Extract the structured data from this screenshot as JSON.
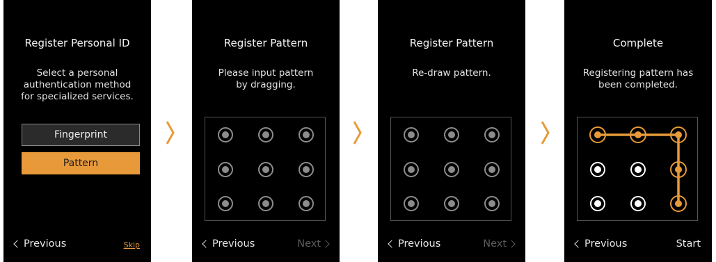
{
  "screens": [
    {
      "title": "Register Personal ID",
      "message": [
        "Select a personal",
        "authentication method",
        "for specialized services."
      ],
      "options": [
        "Fingerprint",
        "Pattern"
      ],
      "selected_option": "Pattern",
      "previous_label": "Previous",
      "skip_label": "Skip"
    },
    {
      "title": "Register Pattern",
      "message": [
        "Please input pattern",
        "by dragging."
      ],
      "previous_label": "Previous",
      "next_label": "Next",
      "next_enabled": false
    },
    {
      "title": "Register Pattern",
      "message": [
        "Re-draw pattern."
      ],
      "previous_label": "Previous",
      "next_label": "Next",
      "next_enabled": false
    },
    {
      "title": "Complete",
      "message": [
        "Registering pattern has",
        "been completed."
      ],
      "previous_label": "Previous",
      "start_label": "Start",
      "pattern_sequence": [
        1,
        2,
        3,
        6,
        9
      ]
    }
  ],
  "colors": {
    "accent": "#e89a3a",
    "screen_bg": "#000000",
    "dot_inactive": "#8c8c8c",
    "dot_white": "#ffffff",
    "disabled_text": "#5c5c5c"
  },
  "icons": [
    "chevron-left-icon",
    "chevron-right-icon",
    "step-arrow-icon"
  ]
}
